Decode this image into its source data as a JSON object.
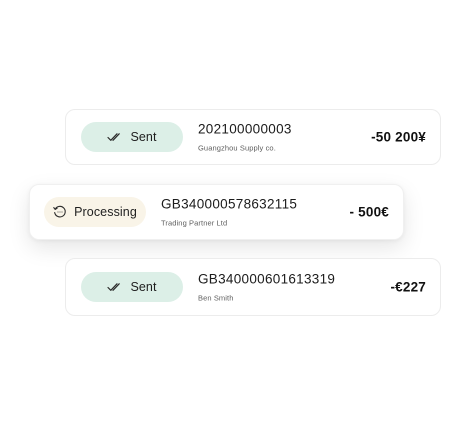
{
  "transactions": [
    {
      "status": "Sent",
      "status_icon": "double-check-icon",
      "reference": "202100000003",
      "counterparty": "Guangzhou Supply co.",
      "amount": "-50 200¥"
    },
    {
      "status": "Processing",
      "status_icon": "clock-history-icon",
      "reference": "GB340000578632115",
      "counterparty": "Trading Partner Ltd",
      "amount": "- 500€"
    },
    {
      "status": "Sent",
      "status_icon": "double-check-icon",
      "reference": "GB340000601613319",
      "counterparty": "Ben Smith",
      "amount": "-€227"
    }
  ],
  "colors": {
    "sent_badge_bg": "#dcefe7",
    "processing_badge_bg": "#f9f4e8",
    "text_primary": "#1b1b1b",
    "text_secondary": "#5f5f5f"
  }
}
